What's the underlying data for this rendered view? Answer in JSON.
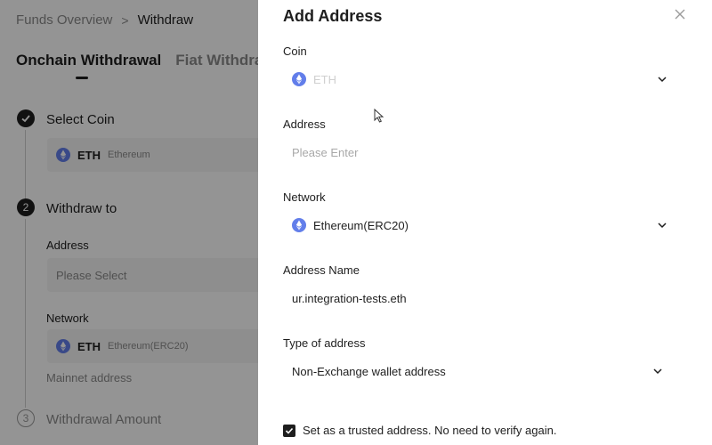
{
  "background": {
    "breadcrumb": {
      "root": "Funds Overview",
      "separator": ">",
      "current": "Withdraw"
    },
    "tabs": [
      "Onchain Withdrawal",
      "Fiat Withdrawal"
    ],
    "steps": [
      {
        "number": "",
        "title": "Select Coin"
      },
      {
        "number": "2",
        "title": "Withdraw to"
      },
      {
        "number": "3",
        "title": "Withdrawal Amount"
      }
    ],
    "coin_box": {
      "symbol": "ETH",
      "name": "Ethereum"
    },
    "address_label": "Address",
    "address_placeholder": "Please Select",
    "network_label": "Network",
    "network_box": {
      "symbol": "ETH",
      "name": "Ethereum(ERC20)"
    },
    "mainnet_label": "Mainnet address"
  },
  "drawer": {
    "title": "Add Address",
    "coin": {
      "label": "Coin",
      "value": "ETH"
    },
    "address": {
      "label": "Address",
      "placeholder": "Please Enter"
    },
    "network": {
      "label": "Network",
      "value": "Ethereum(ERC20)"
    },
    "address_name": {
      "label": "Address Name",
      "value": "ur.integration-tests.eth"
    },
    "type_of_address": {
      "label": "Type of address",
      "value": "Non-Exchange wallet address"
    },
    "trusted": {
      "label": "Set as a trusted address. No need to verify again.",
      "checked": true
    }
  },
  "colors": {
    "eth_purple": "#627EEA",
    "dark": "#1e1e1e"
  }
}
